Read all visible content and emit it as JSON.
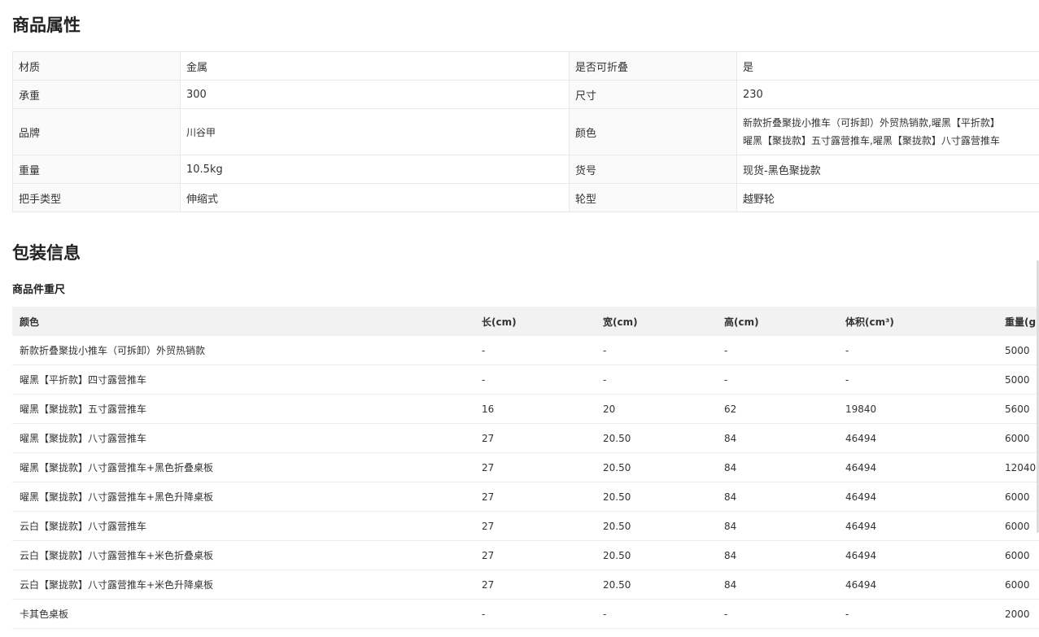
{
  "attributes": {
    "title": "商品属性",
    "rows": [
      {
        "k1": "材质",
        "v1": "金属",
        "k2": "是否可折叠",
        "v2": "是"
      },
      {
        "k1": "承重",
        "v1": "300",
        "k2": "尺寸",
        "v2": "230"
      },
      {
        "k1": "品牌",
        "v1": "川谷甲",
        "k2": "颜色",
        "v2_line1": "新款折叠聚拢小推车（可拆卸）外贸热销款,曜黑【平折款】",
        "v2_line2": "曜黑【聚拢款】五寸露营推车,曜黑【聚拢款】八寸露营推车"
      },
      {
        "k1": "重量",
        "v1": "10.5kg",
        "k2": "货号",
        "v2": "现货-黑色聚拢款"
      },
      {
        "k1": "把手类型",
        "v1": "伸缩式",
        "k2": "轮型",
        "v2": "越野轮"
      }
    ]
  },
  "packaging": {
    "title": "包装信息",
    "subtitle": "商品件重尺",
    "headers": {
      "color": "颜色",
      "length": "长(cm)",
      "width": "宽(cm)",
      "height": "高(cm)",
      "volume": "体积(cm³)",
      "weight": "重量(g)"
    },
    "rows": [
      {
        "color": "新款折叠聚拢小推车（可拆卸）外贸热销款",
        "length": "-",
        "width": "-",
        "height": "-",
        "volume": "-",
        "weight": "5000"
      },
      {
        "color": "曜黑【平折款】四寸露营推车",
        "length": "-",
        "width": "-",
        "height": "-",
        "volume": "-",
        "weight": "5000"
      },
      {
        "color": "曜黑【聚拢款】五寸露营推车",
        "length": "16",
        "width": "20",
        "height": "62",
        "volume": "19840",
        "weight": "5600"
      },
      {
        "color": "曜黑【聚拢款】八寸露营推车",
        "length": "27",
        "width": "20.50",
        "height": "84",
        "volume": "46494",
        "weight": "6000"
      },
      {
        "color": "曜黑【聚拢款】八寸露营推车+黑色折叠桌板",
        "length": "27",
        "width": "20.50",
        "height": "84",
        "volume": "46494",
        "weight": "12040"
      },
      {
        "color": "曜黑【聚拢款】八寸露营推车+黑色升降桌板",
        "length": "27",
        "width": "20.50",
        "height": "84",
        "volume": "46494",
        "weight": "6000"
      },
      {
        "color": "云白【聚拢款】八寸露营推车",
        "length": "27",
        "width": "20.50",
        "height": "84",
        "volume": "46494",
        "weight": "6000"
      },
      {
        "color": "云白【聚拢款】八寸露营推车+米色折叠桌板",
        "length": "27",
        "width": "20.50",
        "height": "84",
        "volume": "46494",
        "weight": "6000"
      },
      {
        "color": "云白【聚拢款】八寸露营推车+米色升降桌板",
        "length": "27",
        "width": "20.50",
        "height": "84",
        "volume": "46494",
        "weight": "6000"
      },
      {
        "color": "卡其色桌板",
        "length": "-",
        "width": "-",
        "height": "-",
        "volume": "-",
        "weight": "2000"
      }
    ]
  }
}
